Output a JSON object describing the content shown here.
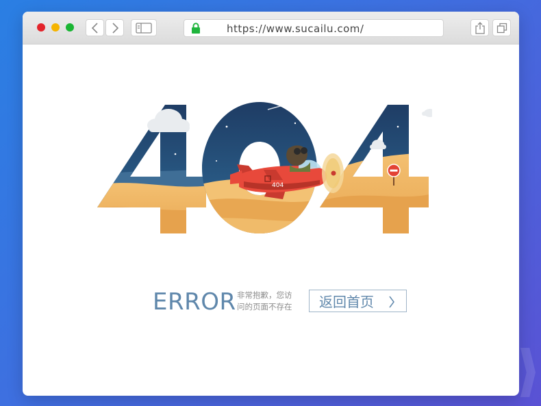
{
  "browser": {
    "url": "https://www.sucailu.com/",
    "traffic_lights": [
      "close",
      "minimize",
      "zoom"
    ],
    "colors": {
      "close": "#e3242b",
      "minimize": "#f5b400",
      "zoom": "#19b533",
      "lock": "#1fb53d"
    }
  },
  "page": {
    "code_digits": [
      "4",
      "0",
      "4"
    ],
    "plane_tail_label": "404",
    "error_word": "ERROR",
    "message_lines": [
      "非常抱歉，您访",
      "问的页面不存在"
    ],
    "home_button_label": "返回首页",
    "accent_color": "#5f87ab"
  }
}
